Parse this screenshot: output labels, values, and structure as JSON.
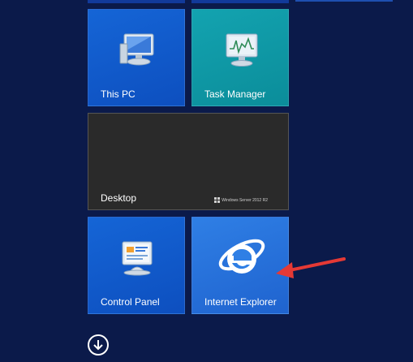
{
  "tiles": {
    "this_pc": {
      "label": "This PC",
      "icon": "computer-monitor-icon"
    },
    "task_manager": {
      "label": "Task Manager",
      "icon": "task-manager-monitor-icon"
    },
    "desktop": {
      "label": "Desktop",
      "watermark": "Windows Server 2012 R2"
    },
    "control_panel": {
      "label": "Control Panel",
      "icon": "control-panel-icon"
    },
    "internet_explorer": {
      "label": "Internet Explorer",
      "icon": "internet-explorer-icon"
    }
  },
  "annotation": {
    "color": "#e53935"
  },
  "colors": {
    "background": "#0b1a4a",
    "tile_blue": "#1565d6",
    "tile_teal": "#13a3b0",
    "tile_desktop": "#2a2a2a",
    "tile_ie": "#2f7fe5"
  },
  "navigation": {
    "apps_button_icon": "arrow-down-circle-icon"
  }
}
